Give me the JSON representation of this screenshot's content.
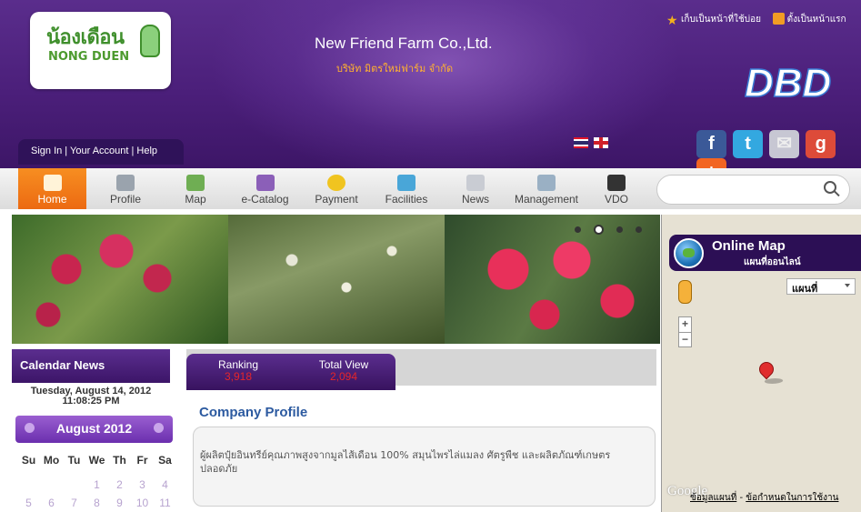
{
  "header": {
    "logo_th": "น้องเดือน",
    "logo_en": "NONG DUEN",
    "company_en": "New Friend Farm Co.,Ltd.",
    "company_th": "บริษัท มิตรใหม่ฟาร์ม จำกัด",
    "toplinks": [
      "เก็บเป็นหน้าที่ใช้บ่อย",
      "ตั้งเป็นหน้าแรก"
    ],
    "dbd_logo": "DBD",
    "account_links": "Sign In  |  Your Account  |  Help",
    "social": [
      "f",
      "t",
      "✉",
      "g",
      "+"
    ]
  },
  "nav": {
    "items": [
      "Home",
      "Profile",
      "Map",
      "e-Catalog",
      "Payment",
      "Facilities",
      "News",
      "Management",
      "VDO"
    ],
    "active": "Home"
  },
  "map": {
    "title": "Online Map",
    "subtitle": "แผนที่ออนไลน์",
    "type_select": "แผนที่",
    "zoom_in": "+",
    "zoom_out": "−",
    "google": "Google",
    "links": [
      "ข้อมูลแผนที่",
      "ข้อกำหนดในการใช้งาน"
    ],
    "links_sep": " - "
  },
  "calendar": {
    "header": "Calendar News",
    "date": "Tuesday, August 14, 2012",
    "time": "11:08:25 PM",
    "month": "August 2012",
    "day_names": [
      "Su",
      "Mo",
      "Tu",
      "We",
      "Th",
      "Fr",
      "Sa"
    ],
    "week1": [
      "",
      "",
      "",
      "1",
      "2",
      "3",
      "4"
    ],
    "week2": [
      "5",
      "6",
      "7",
      "8",
      "9",
      "10",
      "11"
    ]
  },
  "stats": {
    "ranking_label": "Ranking",
    "ranking_value": "3,918",
    "views_label": "Total View",
    "views_value": "2,094"
  },
  "profile": {
    "title": "Company Profile",
    "description": "ผู้ผลิตปุ๋ยอินทรีย์คุณภาพสูงจากมูลไส้เดือน 100% สมุนไพรไล่แมลง ศัตรูพืช และผลิตภัณฑ์เกษตรปลอดภัย"
  },
  "colors": {
    "header_purple": "#4b1f7a",
    "accent_orange": "#f78e21",
    "link_blue": "#2c5aa0",
    "stat_red": "#e5252a"
  }
}
